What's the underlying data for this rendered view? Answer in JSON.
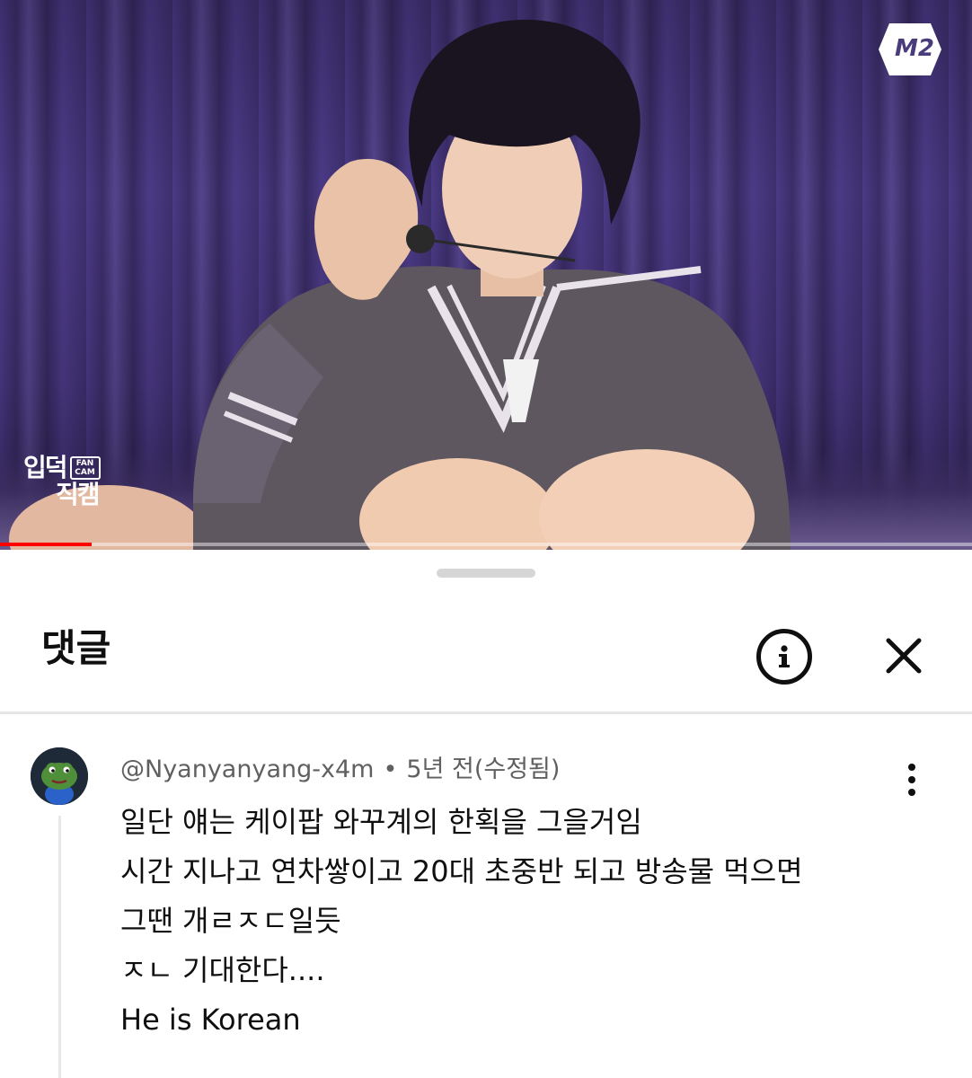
{
  "video": {
    "channel_logo": "M2",
    "fancam_logo_line1": "입덕",
    "fancam_logo_tag": "FAN CAM",
    "fancam_logo_line2": "직캠",
    "progress": 0.094,
    "progress_color": "#ff0000"
  },
  "sheet": {
    "title": "댓글",
    "info_icon": "info-icon",
    "close_icon": "close-icon"
  },
  "comment": {
    "author": "@Nyanyanyang-x4m",
    "separator": "•",
    "time": "5년 전(수정됨)",
    "more_icon": "more-vert-icon",
    "lines": [
      "일단 얘는 케이팝 와꾸계의 한획을 그을거임",
      "시간 지나고 연차쌓이고 20대 초중반 되고 방송물 먹으면",
      "그땐 개ㄹㅈㄷ일듯",
      "ㅈㄴ 기대한다....",
      "He is Korean"
    ]
  },
  "colors": {
    "text_primary": "#0f0f0f",
    "text_secondary": "#606060",
    "divider": "#e6e6e6"
  }
}
